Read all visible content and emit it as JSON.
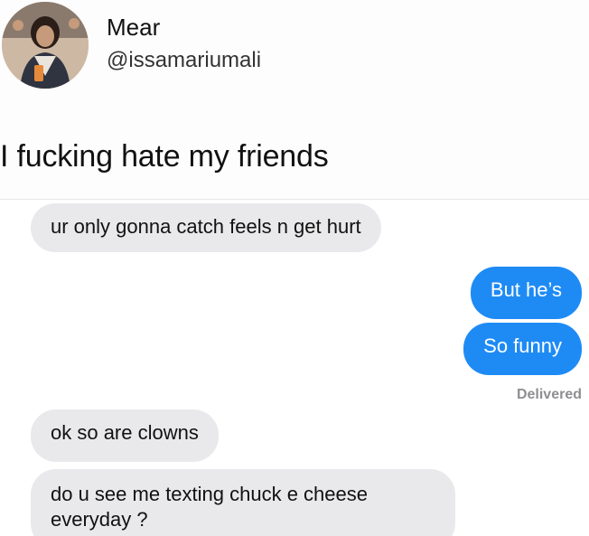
{
  "tweet": {
    "display_name": "Mear",
    "handle": "@issamariumali",
    "text": "I fucking hate my friends"
  },
  "conversation": {
    "messages": [
      {
        "direction": "incoming",
        "text": "ur only gonna catch feels n get hurt"
      },
      {
        "direction": "outgoing",
        "text": "But he’s"
      },
      {
        "direction": "outgoing",
        "text": "So funny"
      },
      {
        "direction": "incoming",
        "text": "ok so are clowns"
      },
      {
        "direction": "incoming",
        "text": "do u see me texting chuck e cheese everyday ?"
      }
    ],
    "status": "Delivered"
  },
  "colors": {
    "outgoing_bubble": "#1e8bf5",
    "incoming_bubble": "#e9e9eb",
    "status_text": "#8e8e93"
  }
}
